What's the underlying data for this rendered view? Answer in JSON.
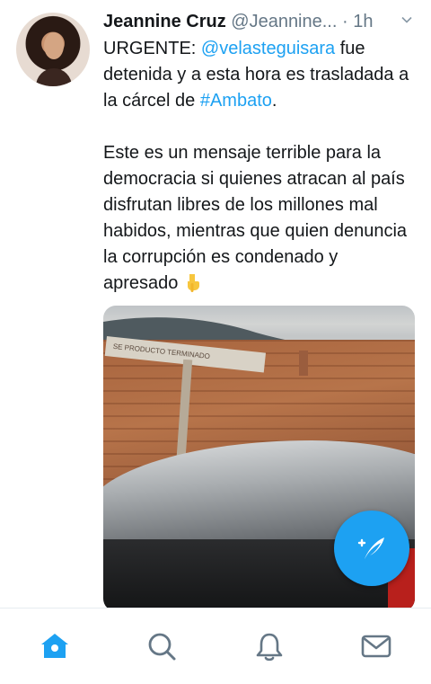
{
  "tweet": {
    "name": "Jeannine Cruz",
    "handle": "@Jeannine...",
    "separator": "·",
    "time": "1h",
    "line1_prefix": "URGENTE: ",
    "mention": "@velasteguisara",
    "line1_after_mention": " fue detenida y a esta hora es trasladada a la cárcel de ",
    "hashtag": "#Ambato",
    "line1_end": ".",
    "paragraph2": "Este es un mensaje terrible para la democracia si quienes atracan al país disfrutan libres de los millones mal habidos, mientras que quien denuncia la corrupción es condenado y apresado ",
    "emoji": "pointing-down-hand",
    "media_sign_text": "SE PRODUCTO TERMINADO"
  },
  "colors": {
    "accent": "#1da1f2",
    "text": "#14171a",
    "secondary": "#657786"
  },
  "fab": {
    "icon": "compose-tweet-icon"
  },
  "tabbar": {
    "tabs": [
      {
        "icon": "home-icon",
        "active": true
      },
      {
        "icon": "search-icon",
        "active": false
      },
      {
        "icon": "notifications-icon",
        "active": false
      },
      {
        "icon": "messages-icon",
        "active": false
      }
    ]
  }
}
